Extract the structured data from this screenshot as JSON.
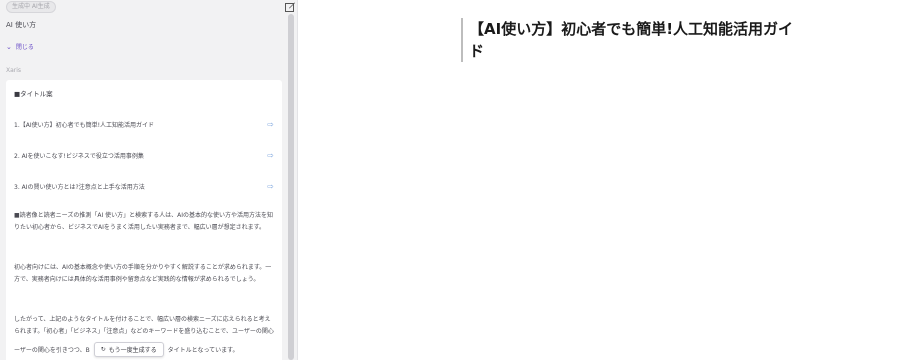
{
  "panel": {
    "badge": "生成中 AI生成",
    "title": "AI 使い方",
    "collapse_label": "閉じる",
    "author_label": "Xaris"
  },
  "card": {
    "heading": "■タイトル案",
    "titles": [
      "1.【AI使い方】初心者でも簡単!人工知能活用ガイド",
      "2. AIを使いこなす!ビジネスで役立つ活用事例集",
      "3. AIの賢い使い方とは?注意点と上手な活用方法"
    ],
    "para1": "■読者像と読者ニーズの推測「AI 使い方」と検索する人は、AIの基本的な使い方や活用方法を知りたい初心者から、ビジネスでAIをうまく活用したい実務者まで、幅広い層が想定されます。",
    "para2": "初心者向けには、AIの基本概念や使い方の手順を分かりやすく解説することが求められます。一方で、実務者向けには具体的な活用事例や留意点など実践的な情報が求められるでしょう。",
    "para3": "したがって、上記のようなタイトルを付けることで、幅広い層の検索ニーズに応えられると考えられます。「初心者」「ビジネス」「注意点」などのキーワードを盛り込むことで、ユーザーの関心を引きつつ、",
    "para3_prefix": "ーザーの関心を引きつつ、B",
    "regen_label": "もう一度生成する",
    "para3_suffix": "タイトルとなっています。"
  },
  "document": {
    "title": "【AI使い方】初心者でも簡単!人工知能活用ガイド"
  },
  "colors": {
    "accent": "#6c50c8",
    "arrow": "#7fa6de",
    "panel_bg": "#f2f2f3"
  },
  "icons": {
    "edit": "edit-icon",
    "insert": "insert-arrow-icon",
    "chevron": "chevron-down-icon",
    "refresh": "refresh-icon"
  }
}
